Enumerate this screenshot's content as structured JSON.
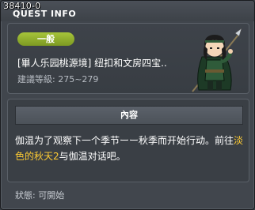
{
  "window": {
    "quest_id": "38410-0",
    "title": "QUEST INFO"
  },
  "quest": {
    "category_badge": "一般",
    "name": "[畢人乐园桃源境] 纽扣和文房四宝..",
    "level_label": "建議等級:",
    "level_range": "275~279",
    "npc_portrait": "warrior-npc-portrait"
  },
  "content": {
    "header": "內容",
    "text_part1": "伽温为了观察下一个季节ーー秋季而开始行动。前往",
    "highlight": "淡色的秋天2",
    "text_part2": "与伽温对话吧。"
  },
  "status": {
    "label": "狀態:",
    "value": "可開始"
  },
  "colors": {
    "badge_green": "#8fb02c",
    "highlight_yellow": "#ffcc33",
    "panel_bg": "#41464d"
  }
}
